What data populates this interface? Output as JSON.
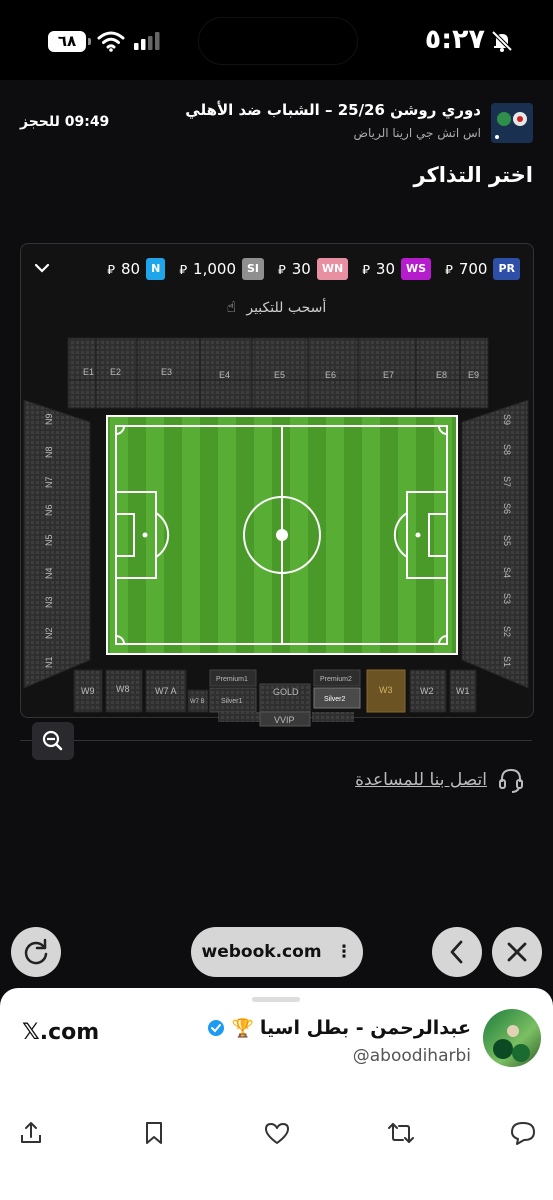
{
  "status_bar": {
    "time": "٥:٢٧",
    "battery": "٦٨"
  },
  "event": {
    "title": "دوري روشن 25/26 – الشباب ضد الأهلي",
    "venue": "اس اتش جي ارينا الرياض",
    "timer": "09:49 للحجز"
  },
  "section_title": "اختر التذاكر",
  "prices": [
    {
      "code": "PR",
      "price": "700",
      "color": "#2d4fa8"
    },
    {
      "code": "WS",
      "price": "30",
      "color": "#b51dcc"
    },
    {
      "code": "WN",
      "price": "30",
      "color": "#e98fa2"
    },
    {
      "code": "SI",
      "price": "1,000",
      "color": "#8f8f8f"
    },
    {
      "code": "N",
      "price": "80",
      "color": "#1fa6ea"
    }
  ],
  "drag_hint": "أسحب للتكبير",
  "stands": {
    "east": [
      "E1",
      "E2",
      "E3",
      "E4",
      "E5",
      "E6",
      "E7",
      "E8",
      "E9"
    ],
    "north": [
      "N9",
      "N8",
      "N7",
      "N6",
      "N5",
      "N4",
      "N3",
      "N2",
      "N1"
    ],
    "south": [
      "S9",
      "S8",
      "S7",
      "S6",
      "S5",
      "S4",
      "S3",
      "S2",
      "S1"
    ],
    "west": {
      "w9": "W9",
      "w8": "W8",
      "w7a": "W7 A",
      "w7b": "W7 B",
      "premium1": "Premium1",
      "silver1": "Silver1",
      "gold": "GOLD",
      "premium2": "Premium2",
      "silver2": "Silver2",
      "w3": "W3",
      "w2": "W2",
      "w1": "W1",
      "vvip": "VVIP"
    }
  },
  "help_text": "اتصل بنا للمساعدة",
  "browser": {
    "url": "webook.com"
  },
  "sheet": {
    "user_name": "عبدالرحمن - بطل اسيا",
    "handle": "@aboodiharbi",
    "site": "𝕏.com"
  }
}
